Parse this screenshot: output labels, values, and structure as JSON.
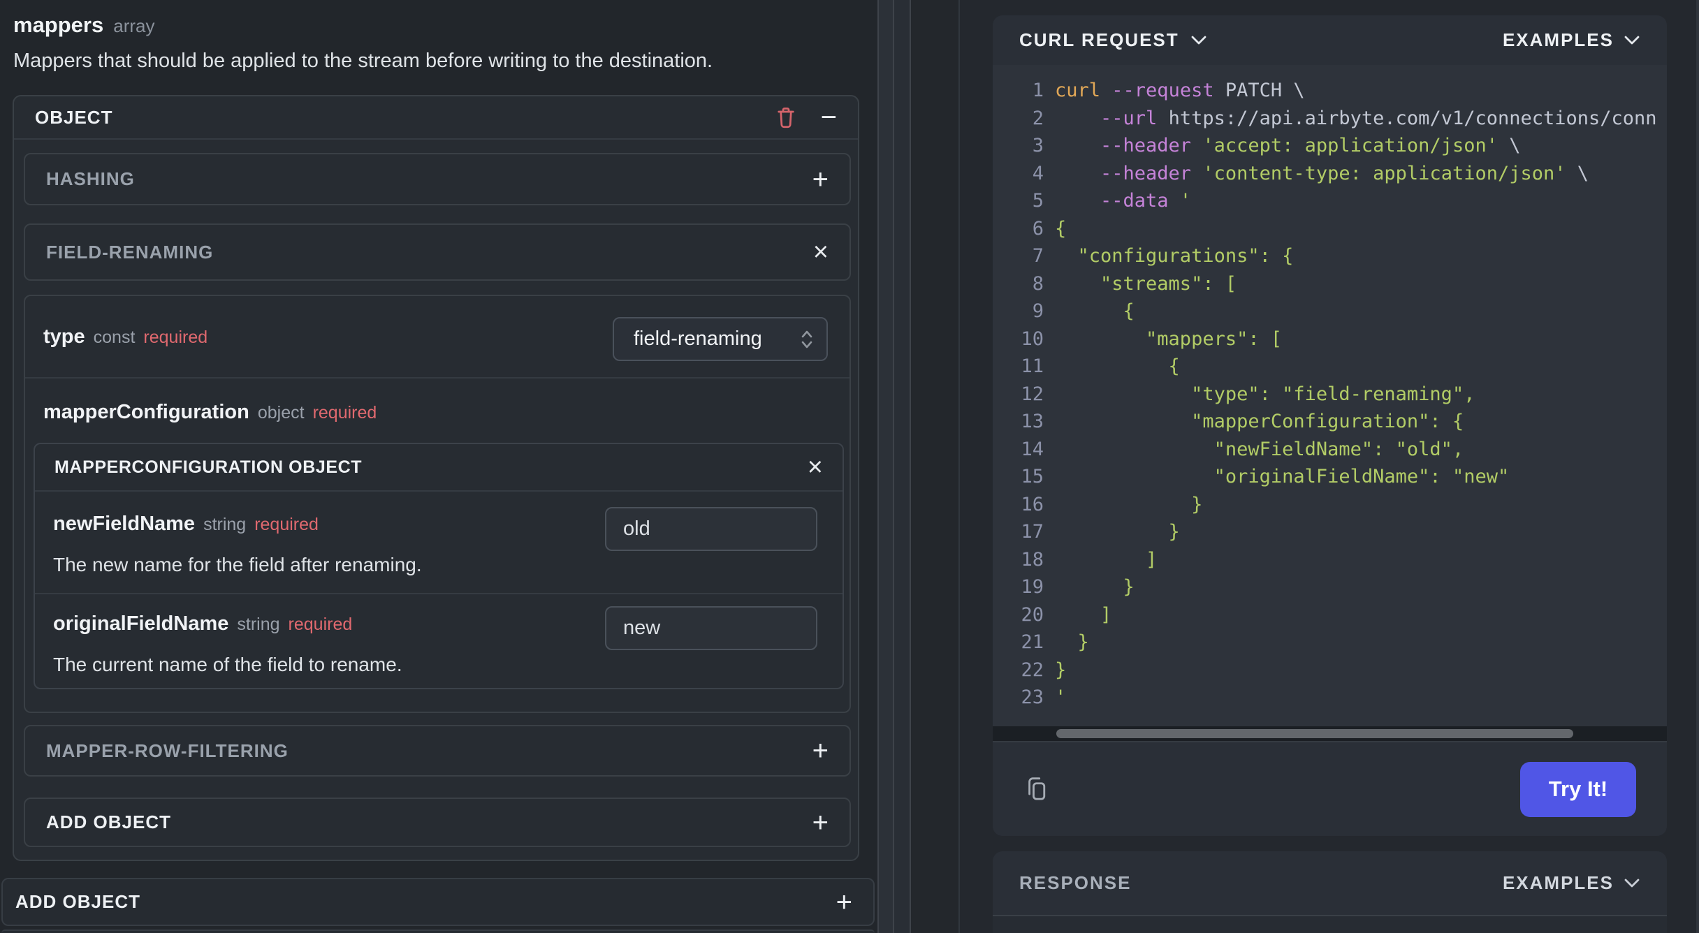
{
  "schema": {
    "title": "mappers",
    "title_type": "array",
    "description": "Mappers that should be applied to the stream before writing to the destination.",
    "object_title": "OBJECT",
    "hashing_title": "HASHING",
    "field_renaming_title": "FIELD-RENAMING",
    "type_row": {
      "name": "type",
      "meta": "const",
      "req": "required",
      "value": "field-renaming"
    },
    "mapper_config_row": {
      "name": "mapperConfiguration",
      "meta": "object",
      "req": "required"
    },
    "mapper_config_box_title": "MAPPERCONFIGURATION OBJECT",
    "fields": [
      {
        "name": "newFieldName",
        "meta": "string",
        "req": "required",
        "value": "old",
        "desc": "The new name for the field after renaming."
      },
      {
        "name": "originalFieldName",
        "meta": "string",
        "req": "required",
        "value": "new",
        "desc": "The current name of the field to rename."
      }
    ],
    "mapper_row_filtering_title": "MAPPER-ROW-FILTERING",
    "add_object_label": "ADD OBJECT",
    "add_object_outer_label": "ADD OBJECT"
  },
  "code_panel": {
    "title": "CURL REQUEST",
    "examples": "EXAMPLES",
    "try_button": "Try It!",
    "lines": [
      {
        "n": "1",
        "t": [
          [
            "cmd",
            "curl"
          ],
          [
            "opt",
            " --request"
          ],
          [
            "pln",
            " PATCH \\"
          ]
        ]
      },
      {
        "n": "2",
        "t": [
          [
            "opt",
            "    --url"
          ],
          [
            "pln",
            " https://api.airbyte.com/v1/connections/conn"
          ]
        ]
      },
      {
        "n": "3",
        "t": [
          [
            "opt",
            "    --header"
          ],
          [
            "str",
            " 'accept: application/json'"
          ],
          [
            "pln",
            " \\"
          ]
        ]
      },
      {
        "n": "4",
        "t": [
          [
            "opt",
            "    --header"
          ],
          [
            "str",
            " 'content-type: application/json'"
          ],
          [
            "pln",
            " \\"
          ]
        ]
      },
      {
        "n": "5",
        "t": [
          [
            "opt",
            "    --data"
          ],
          [
            "str",
            " '"
          ]
        ]
      },
      {
        "n": "6",
        "t": [
          [
            "str",
            "{"
          ]
        ]
      },
      {
        "n": "7",
        "t": [
          [
            "str",
            "  \"configurations\": {"
          ]
        ]
      },
      {
        "n": "8",
        "t": [
          [
            "str",
            "    \"streams\": ["
          ]
        ]
      },
      {
        "n": "9",
        "t": [
          [
            "str",
            "      {"
          ]
        ]
      },
      {
        "n": "10",
        "t": [
          [
            "str",
            "        \"mappers\": ["
          ]
        ]
      },
      {
        "n": "11",
        "t": [
          [
            "str",
            "          {"
          ]
        ]
      },
      {
        "n": "12",
        "t": [
          [
            "str",
            "            \"type\": \"field-renaming\","
          ]
        ]
      },
      {
        "n": "13",
        "t": [
          [
            "str",
            "            \"mapperConfiguration\": {"
          ]
        ]
      },
      {
        "n": "14",
        "t": [
          [
            "str",
            "              \"newFieldName\": \"old\","
          ]
        ]
      },
      {
        "n": "15",
        "t": [
          [
            "str",
            "              \"originalFieldName\": \"new\""
          ]
        ]
      },
      {
        "n": "16",
        "t": [
          [
            "str",
            "            }"
          ]
        ]
      },
      {
        "n": "17",
        "t": [
          [
            "str",
            "          }"
          ]
        ]
      },
      {
        "n": "18",
        "t": [
          [
            "str",
            "        ]"
          ]
        ]
      },
      {
        "n": "19",
        "t": [
          [
            "str",
            "      }"
          ]
        ]
      },
      {
        "n": "20",
        "t": [
          [
            "str",
            "    ]"
          ]
        ]
      },
      {
        "n": "21",
        "t": [
          [
            "str",
            "  }"
          ]
        ]
      },
      {
        "n": "22",
        "t": [
          [
            "str",
            "}"
          ]
        ]
      },
      {
        "n": "23",
        "t": [
          [
            "str",
            "'"
          ]
        ]
      }
    ]
  },
  "response_panel": {
    "title": "RESPONSE",
    "examples": "EXAMPLES"
  },
  "colors": {
    "accent_button": "#5056e6",
    "required_red": "#e0696f",
    "trash_red": "#d5646b",
    "code_cmd": "#e2a857",
    "code_option": "#c583d8",
    "code_string": "#b2cc66",
    "code_plain": "#c3c8d4"
  }
}
